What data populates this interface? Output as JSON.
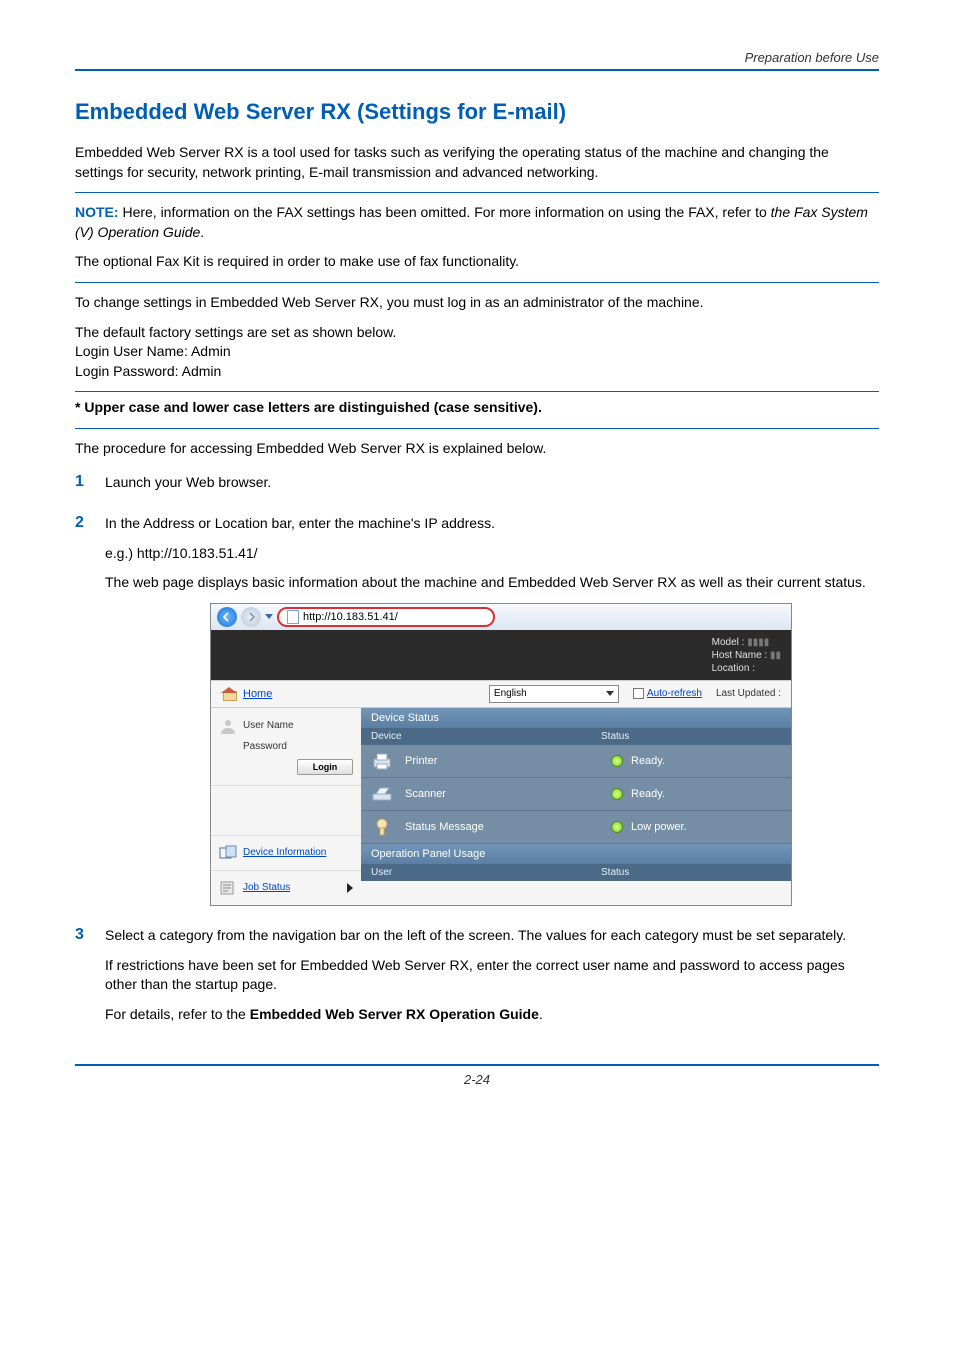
{
  "header": {
    "section": "Preparation before Use"
  },
  "title": "Embedded Web Server RX (Settings for E-mail)",
  "intro": "Embedded Web Server RX is a tool used for tasks such as verifying the operating status of the machine and changing the settings for security, network printing, E-mail transmission and advanced networking.",
  "note": {
    "label": "NOTE:",
    "line1a": " Here, information on the FAX settings has been omitted. For more information on using the FAX, refer to ",
    "line1b": "the Fax System (V) Operation Guide",
    "line1c": ".",
    "line2": "The optional Fax Kit is required in order to make use of fax functionality."
  },
  "p_login_intro": "To change settings in Embedded Web Server RX, you must log in as an administrator of the machine.",
  "p_default": "The default factory settings are set as shown below.",
  "p_user": "Login User Name: Admin",
  "p_pass": "Login Password: Admin",
  "p_case": "* Upper case and lower case letters are distinguished (case sensitive).",
  "p_procedure": "The procedure for accessing Embedded Web Server RX is explained below.",
  "steps": {
    "s1": {
      "num": "1",
      "text": "Launch your Web browser."
    },
    "s2": {
      "num": "2",
      "text": "In the Address or Location bar, enter the machine's IP address.",
      "example": "e.g.) http://10.183.51.41/",
      "desc": "The web page displays basic information about the machine and Embedded Web Server RX as well as their current status."
    },
    "s3": {
      "num": "3",
      "text": "Select a category from the navigation bar on the left of the screen. The values for each category must be set separately.",
      "restrict": "If restrictions have been set for Embedded Web Server RX, enter the correct user name and password to access pages other than the startup page.",
      "detail_a": "For details, refer to the ",
      "detail_b": "Embedded Web Server RX Operation Guide",
      "detail_c": "."
    }
  },
  "screenshot": {
    "url": "http://10.183.51.41/",
    "info": {
      "model": "Model :",
      "host": "Host Name :",
      "location": "Location :"
    },
    "home": "Home",
    "language": "English",
    "auto_refresh": "Auto-refresh",
    "last_updated": "Last Updated :",
    "sidebar": {
      "user": "User Name",
      "pass": "Password",
      "login": "Login",
      "device_info": "Device Information",
      "job_status": "Job Status"
    },
    "main": {
      "device_status": "Device Status",
      "device_col": "Device",
      "status_col": "Status",
      "printer": "Printer",
      "scanner": "Scanner",
      "status_message": "Status Message",
      "ready": "Ready.",
      "low_power": "Low power.",
      "op_usage": "Operation Panel Usage",
      "user_col": "User"
    }
  },
  "page_number": "2-24"
}
